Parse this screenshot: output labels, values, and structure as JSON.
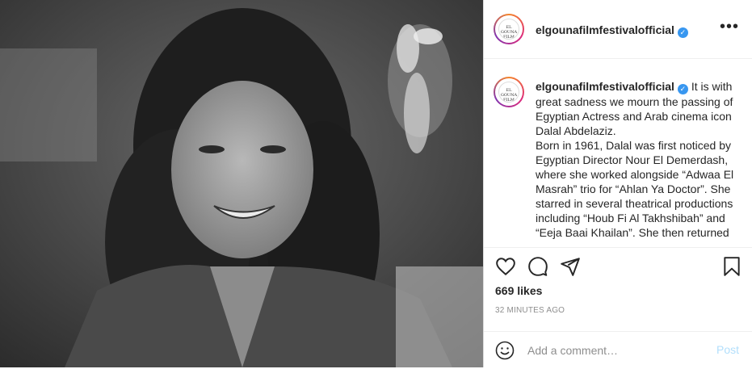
{
  "post": {
    "photo_alt": "Black and white portrait photo",
    "account": {
      "username": "elgounafilmfestivalofficial",
      "verified_symbol": "✓",
      "logo_text": "EL GOUNA FILM FESTIVAL"
    },
    "more_symbol": "•••",
    "caption": {
      "username": "elgounafilmfestivalofficial",
      "text": "It is with great sadness we mourn the passing of Egyptian Actress and Arab cinema icon Dalal Abdelaziz.\nBorn in 1961, Dalal was first noticed by Egyptian Director Nour El Demerdash, where she worked alongside “Adwaa El Masrah” trio for “Ahlan Ya Doctor”. She starred in several theatrical productions including “Houb Fi Al Takhshibah” and “Eeja Baai Khailan”. She then returned"
    },
    "likes": "669 likes",
    "timestamp": "32 MINUTES AGO",
    "comment": {
      "placeholder": "Add a comment…",
      "post_label": "Post"
    },
    "icons": [
      "heart-icon",
      "comment-icon",
      "share-icon",
      "bookmark-icon",
      "emoji-icon",
      "more-icon",
      "verified-icon"
    ],
    "colors": {
      "verified": "#3897f0",
      "post_button_disabled": "#b2dffc",
      "text": "#262626",
      "muted": "#8e8e8e"
    }
  }
}
